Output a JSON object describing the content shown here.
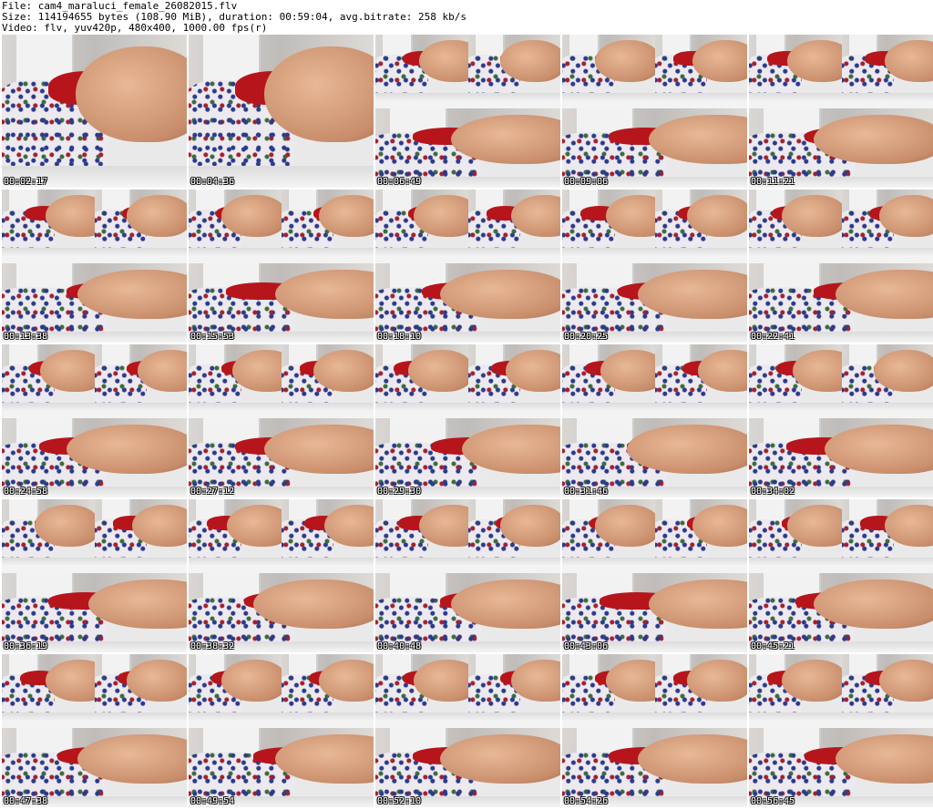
{
  "header": {
    "file_line": "File: cam4_maraluci_female_26082015.flv",
    "size_line": "Size: 114194655 bytes (108.90 MiB), duration: 00:59:04, avg.bitrate: 258 kb/s",
    "video_line": "Video: flv, yuv420p, 480x400, 1000.00 fps(r)"
  },
  "thumbnails": [
    "00:02:17",
    "00:04:36",
    "00:06:49",
    "00:09:06",
    "00:11:21",
    "00:13:38",
    "00:15:53",
    "00:18:10",
    "00:20:25",
    "00:22:41",
    "00:24:58",
    "00:27:12",
    "00:29:30",
    "00:31:46",
    "00:34:02",
    "00:36:19",
    "00:38:32",
    "00:40:48",
    "00:43:06",
    "00:45:21",
    "00:47:38",
    "00:49:54",
    "00:52:10",
    "00:54:26",
    "00:56:45"
  ],
  "colors": {
    "background": "#ffffff",
    "accent_red": "#b7151c",
    "skin": "#e8b896"
  }
}
